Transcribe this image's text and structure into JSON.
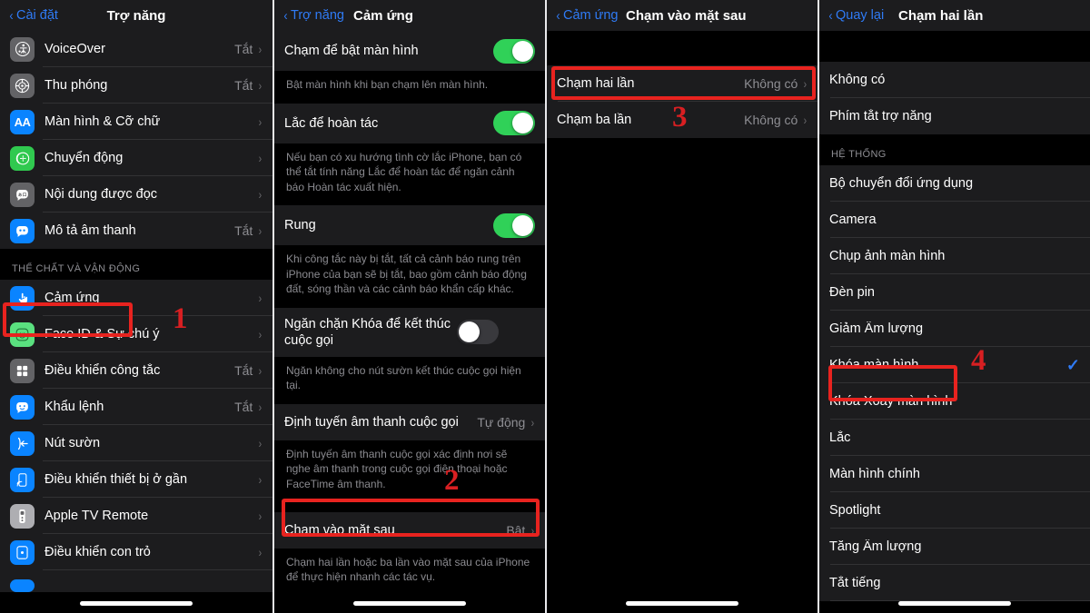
{
  "panels": [
    {
      "id": "accessibility",
      "nav": {
        "back": "Cài đặt",
        "title": "Trợ năng"
      },
      "rows": [
        {
          "label": "VoiceOver",
          "value": "Tắt",
          "icon": "voiceover-icon"
        },
        {
          "label": "Thu phóng",
          "value": "Tắt",
          "icon": "zoom-icon"
        },
        {
          "label": "Màn hình & Cỡ chữ",
          "value": "",
          "icon": "display-text-size-icon"
        },
        {
          "label": "Chuyển động",
          "value": "",
          "icon": "motion-icon"
        },
        {
          "label": "Nội dung được đọc",
          "value": "",
          "icon": "spoken-content-icon"
        },
        {
          "label": "Mô tả âm thanh",
          "value": "Tắt",
          "icon": "audio-description-icon"
        }
      ],
      "section_header": "THỂ CHẤT VÀ VẬN ĐỘNG",
      "rows2": [
        {
          "label": "Cảm ứng",
          "value": "",
          "icon": "touch-icon"
        },
        {
          "label": "Face ID & Sự chú ý",
          "value": "",
          "icon": "faceid-icon"
        },
        {
          "label": "Điều khiển công tắc",
          "value": "Tắt",
          "icon": "switch-control-icon"
        },
        {
          "label": "Khẩu lệnh",
          "value": "Tắt",
          "icon": "voice-control-icon"
        },
        {
          "label": "Nút sườn",
          "value": "",
          "icon": "side-button-icon"
        },
        {
          "label": "Điều khiển thiết bị ở gần",
          "value": "",
          "icon": "nearby-device-icon"
        },
        {
          "label": "Apple TV Remote",
          "value": "",
          "icon": "apple-tv-remote-icon"
        },
        {
          "label": "Điều khiển con trỏ",
          "value": "",
          "icon": "pointer-control-icon"
        }
      ],
      "step": "1"
    },
    {
      "id": "touch",
      "nav": {
        "back": "Trợ năng",
        "title": "Cảm ứng"
      },
      "items": [
        {
          "label": "Chạm để bật màn hình",
          "toggle": "on",
          "note": "Bật màn hình khi bạn chạm lên màn hình."
        },
        {
          "label": "Lắc để hoàn tác",
          "toggle": "on",
          "note": "Nếu bạn có xu hướng tình cờ lắc iPhone, bạn có thể tắt tính năng Lắc để hoàn tác để ngăn cảnh báo Hoàn tác xuất hiện."
        },
        {
          "label": "Rung",
          "toggle": "on",
          "note": "Khi công tắc này bị tắt, tất cả cảnh báo rung trên iPhone của bạn sẽ bị tắt, bao gồm cảnh báo động đất, sóng thần và các cảnh báo khẩn cấp khác."
        },
        {
          "label": "Ngăn chặn Khóa để kết thúc cuộc gọi",
          "toggle": "off",
          "note": "Ngăn không cho nút sườn kết thúc cuộc gọi hiện tại."
        },
        {
          "label": "Định tuyến âm thanh cuộc gọi",
          "value": "Tự động",
          "note": "Định tuyến âm thanh cuộc gọi xác định nơi sẽ nghe âm thanh trong cuộc gọi điện thoại hoặc FaceTime âm thanh."
        },
        {
          "label": "Chạm vào mặt sau",
          "value": "Bật",
          "note": "Chạm hai lần hoặc ba lần vào mặt sau của iPhone để thực hiện nhanh các tác vụ."
        }
      ],
      "step": "2"
    },
    {
      "id": "back-tap",
      "nav": {
        "back": "Cảm ứng",
        "title": "Chạm vào mặt sau"
      },
      "rows": [
        {
          "label": "Chạm hai lần",
          "value": "Không có"
        },
        {
          "label": "Chạm ba lần",
          "value": "Không có"
        }
      ],
      "step": "3"
    },
    {
      "id": "double-tap",
      "nav": {
        "back": "Quay lại",
        "title": "Chạm hai lần"
      },
      "rows_top": [
        {
          "label": "Không có",
          "checked": false
        },
        {
          "label": "Phím tắt trợ năng",
          "checked": false
        }
      ],
      "section_header": "HỆ THỐNG",
      "rows_system": [
        {
          "label": "Bộ chuyển đổi ứng dụng",
          "checked": false
        },
        {
          "label": "Camera",
          "checked": false
        },
        {
          "label": "Chụp ảnh màn hình",
          "checked": false
        },
        {
          "label": "Đèn pin",
          "checked": false
        },
        {
          "label": "Giảm Âm lượng",
          "checked": false
        },
        {
          "label": "Khóa màn hình",
          "checked": true
        },
        {
          "label": "Khóa Xoay màn hình",
          "checked": false
        },
        {
          "label": "Lắc",
          "checked": false
        },
        {
          "label": "Màn hình chính",
          "checked": false
        },
        {
          "label": "Spotlight",
          "checked": false
        },
        {
          "label": "Tăng Âm lượng",
          "checked": false
        },
        {
          "label": "Tắt tiếng",
          "checked": false
        }
      ],
      "step": "4"
    }
  ],
  "glyphs": {
    "chevron": "›",
    "back_chevron": "‹",
    "check": "✓"
  },
  "colors": {
    "accent_blue": "#2f7bf6",
    "toggle_on": "#30d158",
    "highlight_red": "#e8231f",
    "row_bg": "#1c1c1e",
    "page_bg": "#000000",
    "secondary_text": "#8e8e93"
  }
}
